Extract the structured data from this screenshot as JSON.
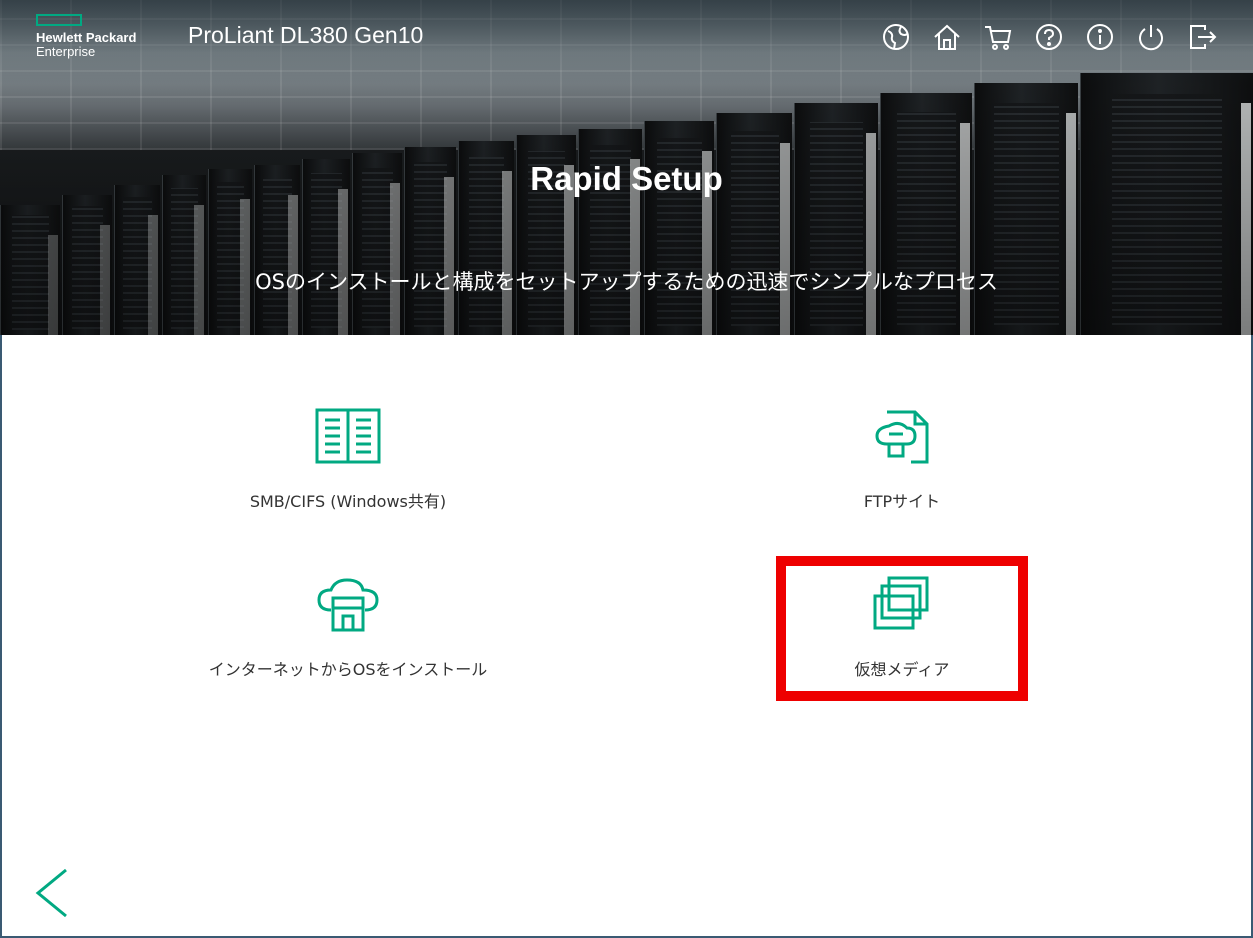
{
  "header": {
    "logo_line1": "Hewlett Packard",
    "logo_line2": "Enterprise",
    "product": "ProLiant DL380 Gen10",
    "icons": [
      "globe-icon",
      "home-icon",
      "cart-icon",
      "help-icon",
      "info-icon",
      "power-icon",
      "logout-icon"
    ]
  },
  "banner": {
    "title": "Rapid Setup",
    "subtitle": "OSのインストールと構成をセットアップするための迅速でシンプルなプロセス"
  },
  "options": [
    {
      "id": "smb",
      "label": "SMB/CIFS (Windows共有)",
      "icon": "book-icon"
    },
    {
      "id": "ftp",
      "label": "FTPサイト",
      "icon": "ftp-cloud-icon"
    },
    {
      "id": "internet",
      "label": "インターネットからOSをインストール",
      "icon": "cloud-download-icon"
    },
    {
      "id": "virtual-media",
      "label": "仮想メディア",
      "icon": "virtual-media-icon",
      "highlighted": true
    }
  ],
  "colors": {
    "accent": "#01a982",
    "highlight": "#ee0000",
    "header_text": "#ffffff",
    "label_text": "#333333"
  },
  "nav": {
    "back_icon": "chevron-left-icon"
  }
}
